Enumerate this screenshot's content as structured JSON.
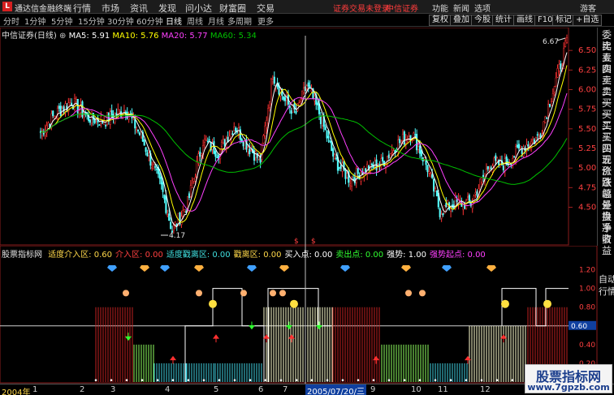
{
  "titlebar": {
    "logo": "L",
    "app_name": "通达信金融终端",
    "menu": [
      "行情",
      "市场",
      "资讯",
      "发现",
      "问小达",
      "财富圈",
      "交易"
    ],
    "login_warning": "证券交易未登录",
    "broker": "中信证券",
    "right_menu": [
      "功能",
      "新闻",
      "选项",
      "游客"
    ]
  },
  "toolbar": {
    "periods": [
      "分时",
      "1分钟",
      "5分钟",
      "15分钟",
      "30分钟",
      "60分钟",
      "日线",
      "周线",
      "月线",
      "多周期",
      "更多"
    ],
    "active_period": "日线",
    "buttons": [
      "复权",
      "叠加",
      "今股",
      "统计",
      "画线",
      "F10",
      "标记",
      "+自选"
    ]
  },
  "ma_line": {
    "stock": "中信证券(日线)",
    "ma5": "MA5: 5.91",
    "ma10": "MA10: 5.76",
    "ma20": "MA20: 5.77",
    "ma60": "MA60: 5.34"
  },
  "price_axis": [
    "6.50",
    "6.25",
    "6.00",
    "5.75",
    "5.50",
    "5.25",
    "5.00",
    "4.75",
    "4.50"
  ],
  "price_annotations": {
    "high": "6.67",
    "low": "4.17"
  },
  "side_panel": [
    "委比",
    "卖五",
    "卖四",
    "卖三",
    "卖二",
    "卖一",
    "买一",
    "买二",
    "买三",
    "买四",
    "买五",
    "现价",
    "涨跌",
    "涨幅",
    "总量",
    "外盘",
    "换手",
    "净资",
    "收益"
  ],
  "side_panel_bottom": [
    "自动",
    "行情"
  ],
  "indicator_line": {
    "name": "股票指标网",
    "items": [
      {
        "label": "适度介入区: 0.60",
        "color": "#ffd84a"
      },
      {
        "label": "介入区: 0.00",
        "color": "#ff4040"
      },
      {
        "label": "适度戳离区: 0.00",
        "color": "#40e0e0"
      },
      {
        "label": "戳离区: 0.00",
        "color": "#ffd84a"
      },
      {
        "label": "买入点: 0.00",
        "color": "#ffffff"
      },
      {
        "label": "卖出点: 0.00",
        "color": "#30ff30"
      },
      {
        "label": "强势: 1.00",
        "color": "#ffffff"
      },
      {
        "label": "强势起点: 0.00",
        "color": "#ff40ff"
      }
    ]
  },
  "indicator_axis": [
    "1.20",
    "1.00",
    "0.80",
    "0.60",
    "0.40",
    "0.20",
    "0.00"
  ],
  "indicator_current": "0.60",
  "bottombar": {
    "year": "2004年",
    "months": [
      "1",
      "2",
      "3",
      "4",
      "5",
      "6",
      "7",
      "8",
      "9",
      "10",
      "11",
      "12",
      "1"
    ],
    "cursor_date": "2005/07/20/三"
  },
  "watermark": {
    "line1": "股票指标网",
    "line2": "www.7gpzb.com"
  },
  "colors": {
    "up": "#ff3232",
    "down": "#54ffff",
    "ma5": "#ffffff",
    "ma10": "#ffff00",
    "ma20": "#ff40ff",
    "ma60": "#00c000"
  }
}
